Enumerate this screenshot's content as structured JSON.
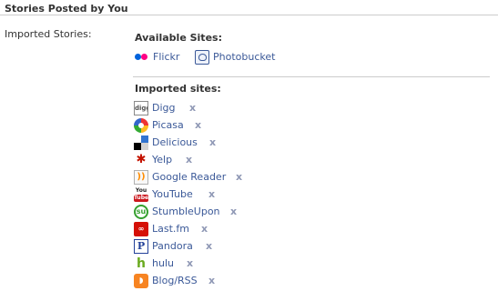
{
  "section": {
    "title": "Stories Posted by You",
    "left_label": "Imported Stories:"
  },
  "available": {
    "label": "Available Sites:",
    "sites": [
      {
        "name": "Flickr",
        "icon": "flickr-icon"
      },
      {
        "name": "Photobucket",
        "icon": "photobucket-icon"
      }
    ]
  },
  "imported": {
    "label": "Imported sites:",
    "remove_glyph": "x",
    "sites": [
      {
        "name": "Digg",
        "icon": "digg-icon",
        "icon_text": "digg"
      },
      {
        "name": "Picasa",
        "icon": "picasa-icon",
        "icon_text": ""
      },
      {
        "name": "Delicious",
        "icon": "delicious-icon",
        "icon_text": ""
      },
      {
        "name": "Yelp",
        "icon": "yelp-icon",
        "icon_text": "✱"
      },
      {
        "name": "Google Reader",
        "icon": "google-reader-icon",
        "icon_text": "))"
      },
      {
        "name": "YouTube",
        "icon": "youtube-icon",
        "icon_text": ""
      },
      {
        "name": "StumbleUpon",
        "icon": "stumbleupon-icon",
        "icon_text": "su"
      },
      {
        "name": "Last.fm",
        "icon": "lastfm-icon",
        "icon_text": "∞"
      },
      {
        "name": "Pandora",
        "icon": "pandora-icon",
        "icon_text": "P"
      },
      {
        "name": "hulu",
        "icon": "hulu-icon",
        "icon_text": "h"
      },
      {
        "name": "Blog/RSS",
        "icon": "rss-icon",
        "icon_text": "◗"
      }
    ]
  },
  "colors": {
    "link": "#3b5998",
    "remove": "#8f98b5",
    "divider": "#cccccc"
  }
}
